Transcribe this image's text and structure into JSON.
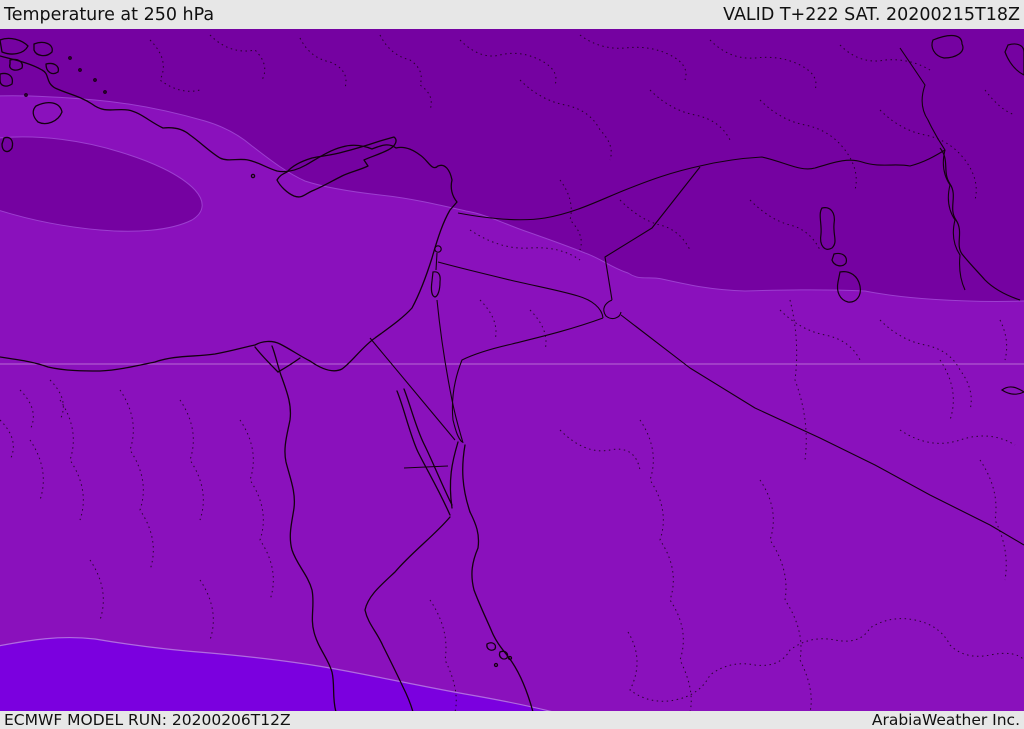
{
  "header": {
    "title": "Temperature at 250 hPa",
    "validity": "VALID T+222 SAT. 20200215T18Z"
  },
  "footer": {
    "model_run": "ECMWF MODEL RUN: 20200206T12Z",
    "provider": "ArabiaWeather Inc."
  },
  "map": {
    "description": "temperature shading over Middle East",
    "colors": {
      "bar_bg": "#e7e7e7",
      "band_cold_dark": "#7502A1",
      "band_mid": "#8A11BC",
      "band_warm_bright": "#7B00DF",
      "band_edge_dark": "#9c3ecf",
      "band_edge_bright": "#b06ae0",
      "border_line": "#14000f",
      "graticule": "#dfb3ea"
    }
  }
}
